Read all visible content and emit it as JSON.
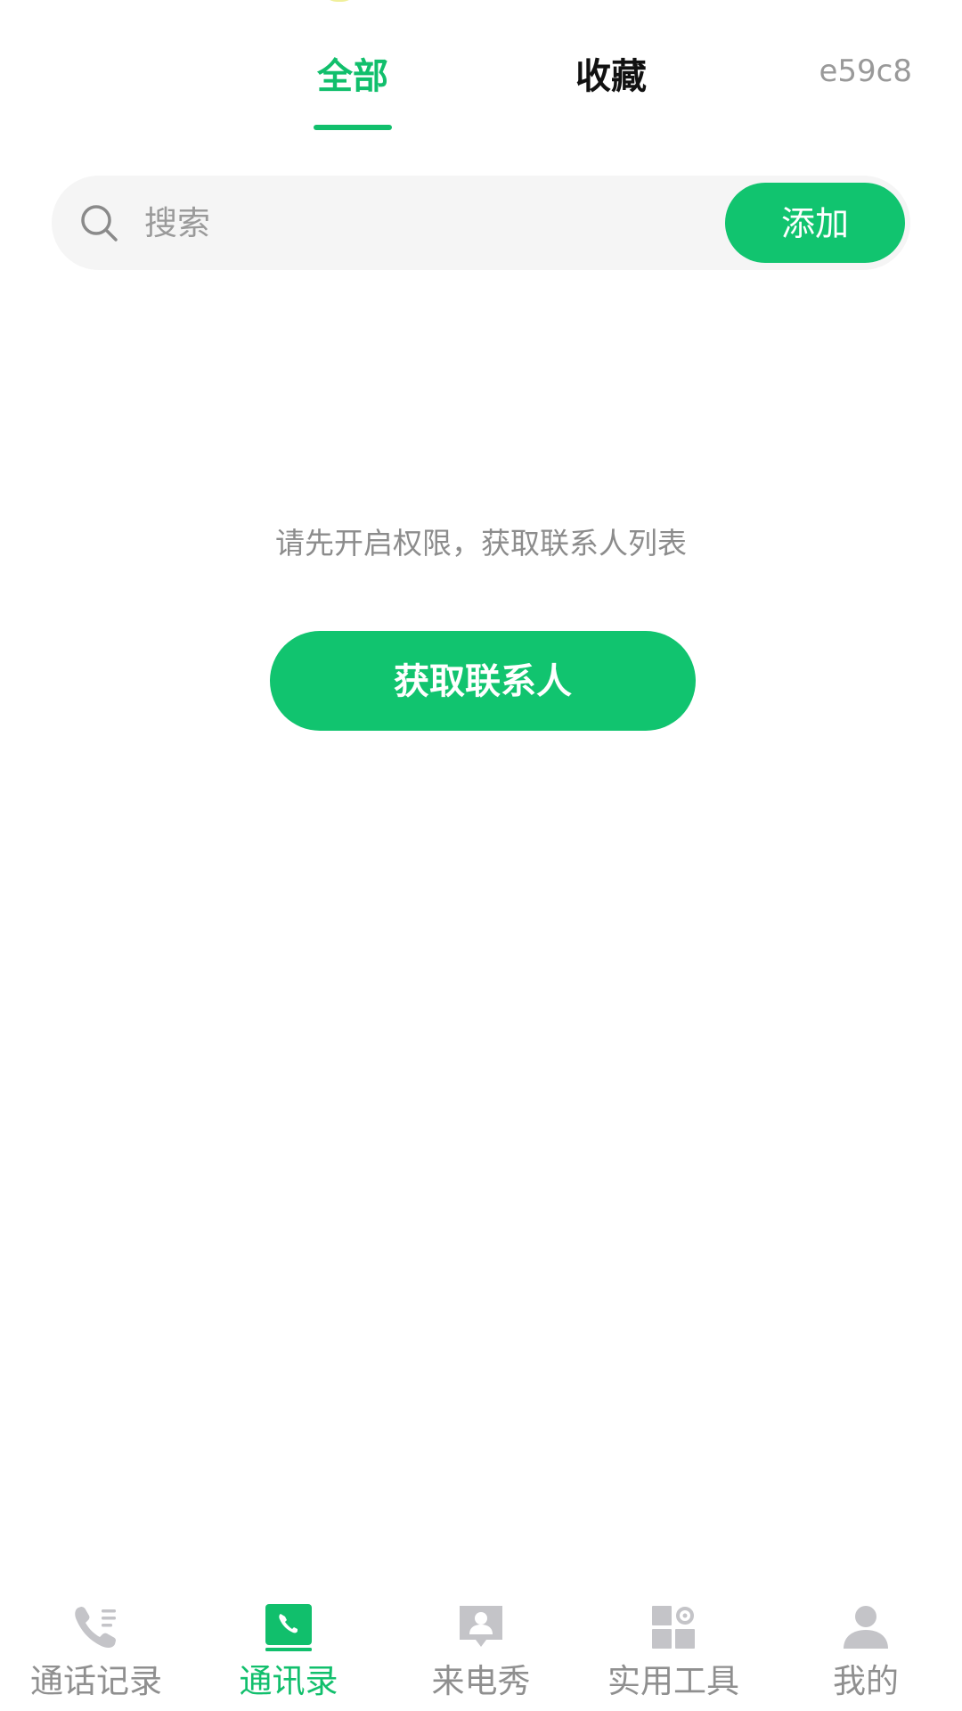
{
  "header": {
    "tabs": [
      {
        "label": "全部",
        "active": true
      },
      {
        "label": "收藏",
        "active": false
      }
    ],
    "corner_code": "e59c8"
  },
  "search": {
    "placeholder": "搜索",
    "value": "",
    "add_label": "添加"
  },
  "empty_state": {
    "hint": "请先开启权限，获取联系人列表",
    "button_label": "获取联系人"
  },
  "bottom_nav": {
    "items": [
      {
        "label": "通话记录",
        "icon": "call-log-icon",
        "active": false
      },
      {
        "label": "通讯录",
        "icon": "contacts-book-icon",
        "active": true
      },
      {
        "label": "来电秀",
        "icon": "caller-show-icon",
        "active": false
      },
      {
        "label": "实用工具",
        "icon": "tools-icon",
        "active": false
      },
      {
        "label": "我的",
        "icon": "profile-icon",
        "active": false
      }
    ]
  },
  "colors": {
    "accent": "#11c46f",
    "inactive": "#c4c4c8",
    "background": "#ffffff",
    "search_bg": "#f5f5f5"
  }
}
